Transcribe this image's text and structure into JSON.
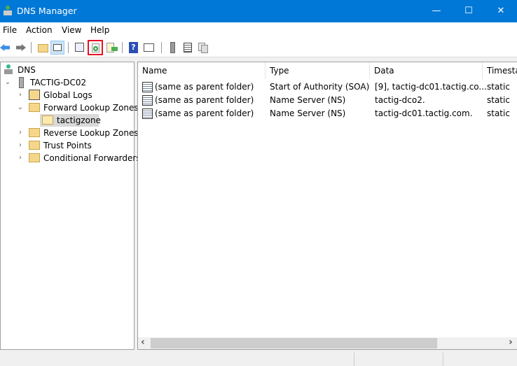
{
  "window": {
    "title": "DNS Manager",
    "minimize": "—",
    "maximize": "☐",
    "close": "✕"
  },
  "menu": [
    "File",
    "Action",
    "View",
    "Help"
  ],
  "toolbar": {
    "icons": [
      "back-icon",
      "forward-icon",
      "up-folder-icon",
      "show-hide-console-tree-icon",
      "properties-icon",
      "refresh-icon",
      "export-list-icon",
      "help-icon",
      "show-hide-action-pane-icon",
      "server-icon",
      "record-list-icon",
      "copy-icon"
    ],
    "highlighted": "refresh-icon",
    "highlight_color": "#e81123"
  },
  "tree": [
    {
      "label": "DNS",
      "level": 0,
      "expanded": null
    },
    {
      "label": "TACTIG-DC02",
      "level": 1,
      "expanded": true
    },
    {
      "label": "Global Logs",
      "level": 2,
      "expanded": false
    },
    {
      "label": "Forward Lookup Zones",
      "level": 2,
      "expanded": true
    },
    {
      "label": "tactigzone",
      "level": 3,
      "selected": true
    },
    {
      "label": "Reverse Lookup Zones",
      "level": 2,
      "expanded": false
    },
    {
      "label": "Trust Points",
      "level": 2,
      "expanded": false
    },
    {
      "label": "Conditional Forwarders",
      "level": 2,
      "expanded": false
    }
  ],
  "list": {
    "columns": [
      "Name",
      "Type",
      "Data",
      "Timestamp"
    ],
    "rows": [
      [
        "(same as parent folder)",
        "Start of Authority (SOA)",
        "[9], tactig-dc01.tactig.co...",
        "static"
      ],
      [
        "(same as parent folder)",
        "Name Server (NS)",
        "tactig-dco2.",
        "static"
      ],
      [
        "(same as parent folder)",
        "Name Server (NS)",
        "tactig-dc01.tactig.com.",
        "static"
      ]
    ]
  },
  "scroll": {
    "left": "‹",
    "right": "›"
  },
  "colors": {
    "titlebar": "#0078d7",
    "selection": "#d9d9d9"
  }
}
